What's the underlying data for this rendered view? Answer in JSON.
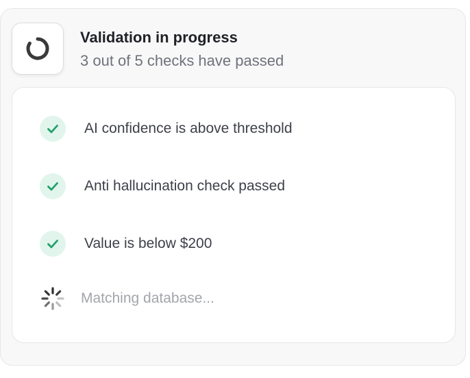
{
  "header": {
    "title": "Validation in progress",
    "subtitle": "3 out of 5 checks have passed",
    "status_icon": "loading-spinner-icon"
  },
  "checks": [
    {
      "label": "AI confidence is above threshold",
      "status": "passed",
      "icon": "check-icon"
    },
    {
      "label": "Anti hallucination check passed",
      "status": "passed",
      "icon": "check-icon"
    },
    {
      "label": "Value is below $200",
      "status": "passed",
      "icon": "check-icon"
    }
  ],
  "pending": {
    "label": "Matching database...",
    "status": "in-progress",
    "icon": "loading-dots-icon"
  },
  "colors": {
    "success": "#22a06b",
    "success_bg": "#e1f5ec",
    "spinner": "#3a3a3a"
  }
}
